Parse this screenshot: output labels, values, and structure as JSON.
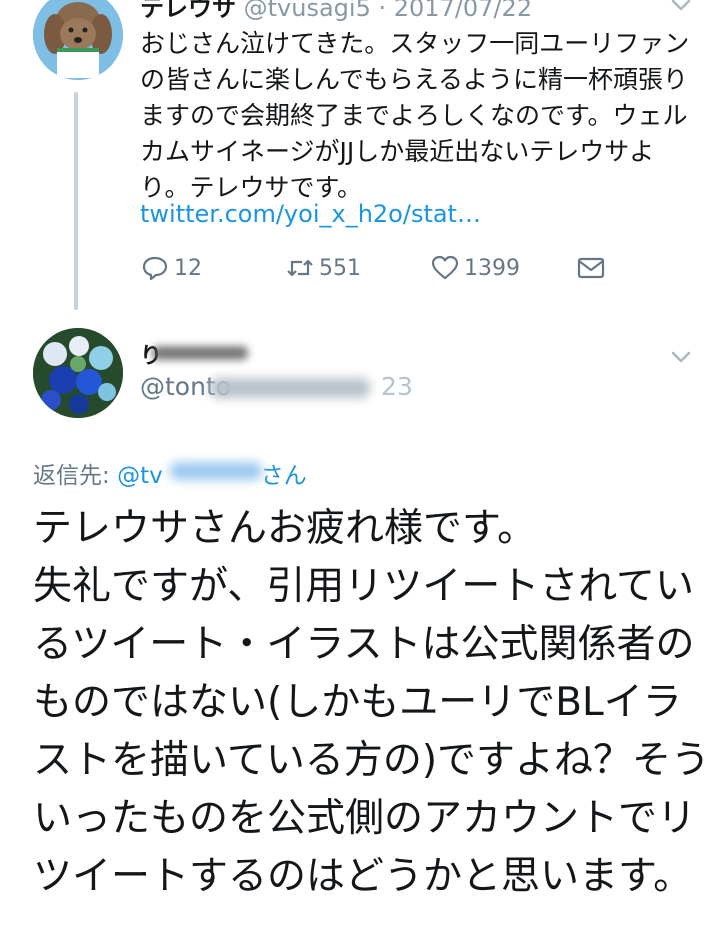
{
  "tweet1": {
    "display_name": "テレウサ",
    "handle": "@tvusagi5",
    "date": "· 2017/07/22",
    "text": "おじさん泣けてきた。スタッフ一同ユーリファンの皆さんに楽しんでもらえるように精一杯頑張りますので会期終了までよろしくなのです。ウェルカムサイネージがJJしか最近出ないテレウサより。テレウサです。",
    "link": "twitter.com/yoi_x_h2o/stat…",
    "actions": {
      "reply_count": "12",
      "retweet_count": "551",
      "like_count": "1399"
    }
  },
  "tweet2": {
    "display_name_visible": "り",
    "handle_visible_start": "@tonto",
    "handle_visible_end": "23",
    "reply_to_label": "返信先:",
    "reply_to_user_start": "@tv",
    "reply_to_user_end": "さん",
    "text": "テレウサさんお疲れ様です。\n失礼ですが、引用リツイートされているツイート・イラストは公式関係者のものではない(しかもユーリでBLイラストを描いている方の)ですよね？そういったものを公式側のアカウントでリツイートするのはどうかと思います。"
  },
  "colors": {
    "link": "#1b95e0",
    "secondary_text": "#657786",
    "thread_line": "#c8d2db"
  }
}
